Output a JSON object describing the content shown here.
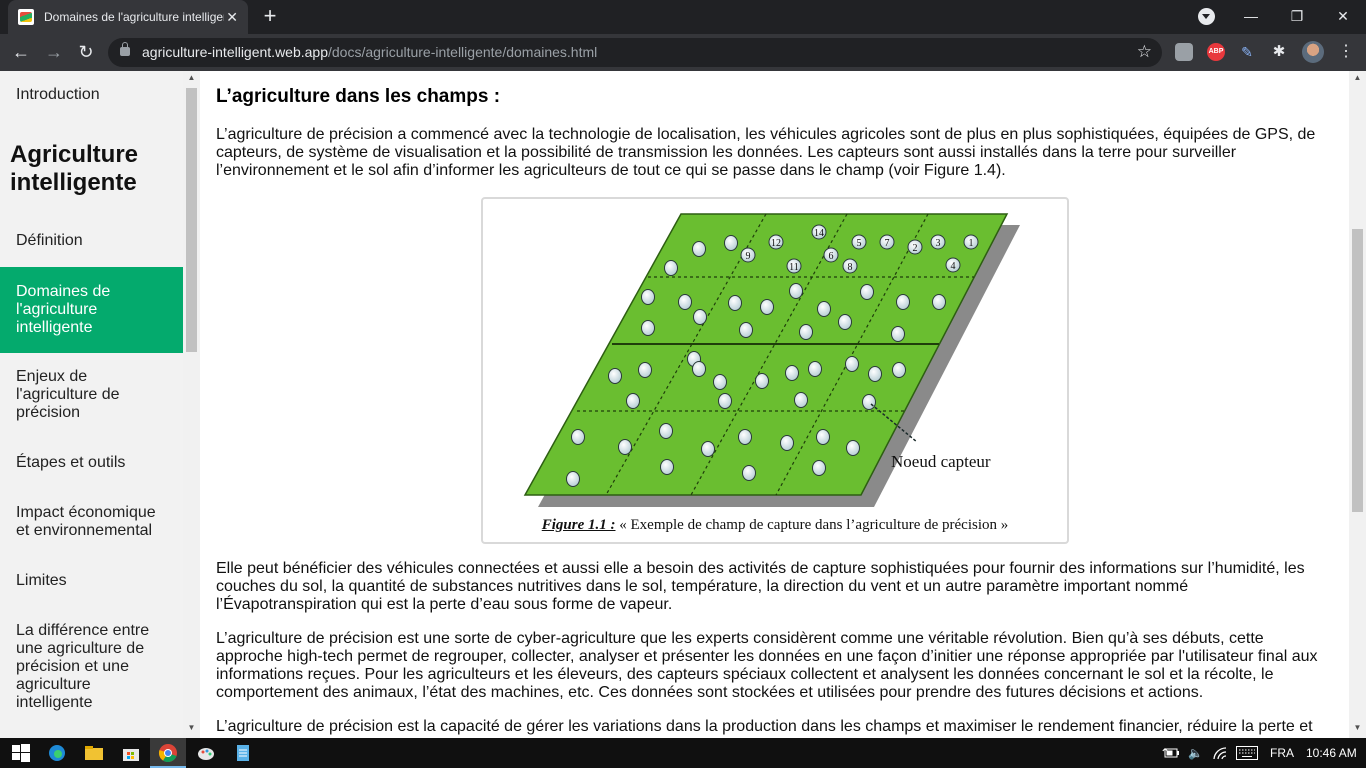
{
  "browser": {
    "tab_title": "Domaines de l'agriculture intelligente",
    "tab_close": "✕",
    "new_tab": "+",
    "url_host": "agriculture-intelligent.web.app",
    "url_path": "/docs/agriculture-intelligente/domaines.html",
    "icons": [
      "back-arrow-icon",
      "forward-arrow-icon",
      "reload-icon",
      "lock-icon",
      "star-icon",
      "download-extension-icon",
      "adblock-plus-icon",
      "pen-extension-icon",
      "extensions-puzzle-icon",
      "profile-avatar",
      "more-menu-icon"
    ],
    "abp_label": "ABP"
  },
  "sidebar": {
    "intro": "Introduction",
    "heading": "Agriculture intelligente",
    "items": [
      "Définition",
      "Domaines de l'agriculture intelligente",
      "Enjeux de l'agriculture de précision",
      "Étapes et outils",
      "Impact économique et environnemental",
      "Limites",
      "La différence entre une agriculture de précision et une agriculture intelligente"
    ],
    "active_color": "#04aa6d"
  },
  "main": {
    "heading": "L’agriculture dans les champs :",
    "para1": "L’agriculture de précision a commencé avec la technologie de localisation, les véhicules agricoles sont de plus en plus sophistiquées, équipées de GPS, de capteurs, de système de visualisation et la possibilité de transmission les données. Les capteurs sont aussi installés dans la terre pour surveiller l’environnement et le sol afin d’informer les agriculteurs de tout ce qui se passe dans le champ (voir Figure 1.4).",
    "figure": {
      "node_label": "Noeud capteur",
      "numbers": [
        "14",
        "12",
        "9",
        "6",
        "5",
        "7",
        "2",
        "3",
        "1",
        "11",
        "8",
        "4"
      ],
      "caption_label": "Figure 1.1 :",
      "caption_text": " « Exemple de champ de capture dans l’agriculture de précision »",
      "field_color": "#6abe30"
    },
    "para2": "Elle peut bénéficier des véhicules connectées et aussi elle a besoin des activités de capture sophistiquées pour fournir des informations sur l’humidité, les couches du sol, la quantité de substances nutritives dans le sol, température, la direction du vent et un autre paramètre important nommé l’Évapotranspiration qui est la perte d’eau sous forme de vapeur.",
    "para3": "L’agriculture de précision est une sorte de cyber-agriculture que les experts considèrent comme une véritable révolution. Bien qu’à ses débuts, cette approche high-tech permet de regrouper, collecter, analyser et présenter les données en une façon d’initier une réponse appropriée par l'utilisateur final aux informations reçues. Pour les agriculteurs et les éleveurs, des capteurs spéciaux collectent et analysent les données concernant le sol et la récolte, le comportement des animaux, l’état des machines, etc. Ces données sont stockées et utilisées pour prendre des futures décisions et actions.",
    "para4": "L’agriculture de précision est la capacité de gérer les variations dans la production dans les champs et maximiser le rendement financier, réduire la perte et"
  },
  "taskbar": {
    "language": "FRA",
    "time": "10:46 AM",
    "icons": [
      "windows-start-icon",
      "edge-icon",
      "file-explorer-icon",
      "store-icon",
      "chrome-icon",
      "paint-icon",
      "notepad-icon",
      "battery-icon",
      "volume-icon",
      "wifi-icon",
      "keyboard-icon"
    ]
  }
}
